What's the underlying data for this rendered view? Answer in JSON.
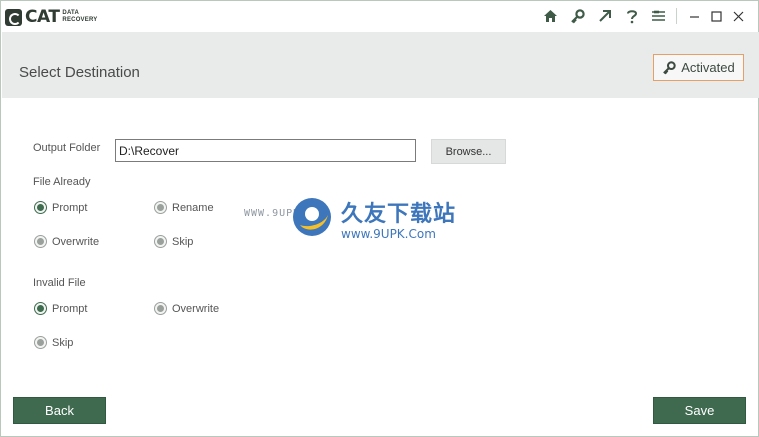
{
  "app": {
    "logo_main": "CAT",
    "logo_sub_line1": "DATA",
    "logo_sub_line2": "RECOVERY"
  },
  "titlebar": {
    "icons": [
      "home-icon",
      "key-icon",
      "arrow-up-right-icon",
      "help-icon",
      "menu-icon"
    ],
    "window_controls": [
      "minimize",
      "maximize",
      "close"
    ]
  },
  "header": {
    "title": "Select Destination",
    "activated_label": "Activated"
  },
  "output": {
    "label": "Output Folder",
    "value": "D:\\Recover",
    "browse_label": "Browse..."
  },
  "file_already": {
    "label": "File Already",
    "options": [
      "Prompt",
      "Rename",
      "Overwrite",
      "Skip"
    ],
    "selected": "Prompt"
  },
  "invalid_file": {
    "label": "Invalid File",
    "options": [
      "Prompt",
      "Overwrite",
      "Skip"
    ],
    "selected": "Prompt"
  },
  "footer": {
    "back_label": "Back",
    "save_label": "Save"
  },
  "watermark": {
    "url_top": "WWW.9UPK.COM",
    "cn_text": "久友下载站",
    "url_bottom": "www.9UPK.Com"
  },
  "colors": {
    "accent": "#3f6a4f",
    "header_bg": "#e8ebe9",
    "activated_border": "#e5a06a"
  }
}
